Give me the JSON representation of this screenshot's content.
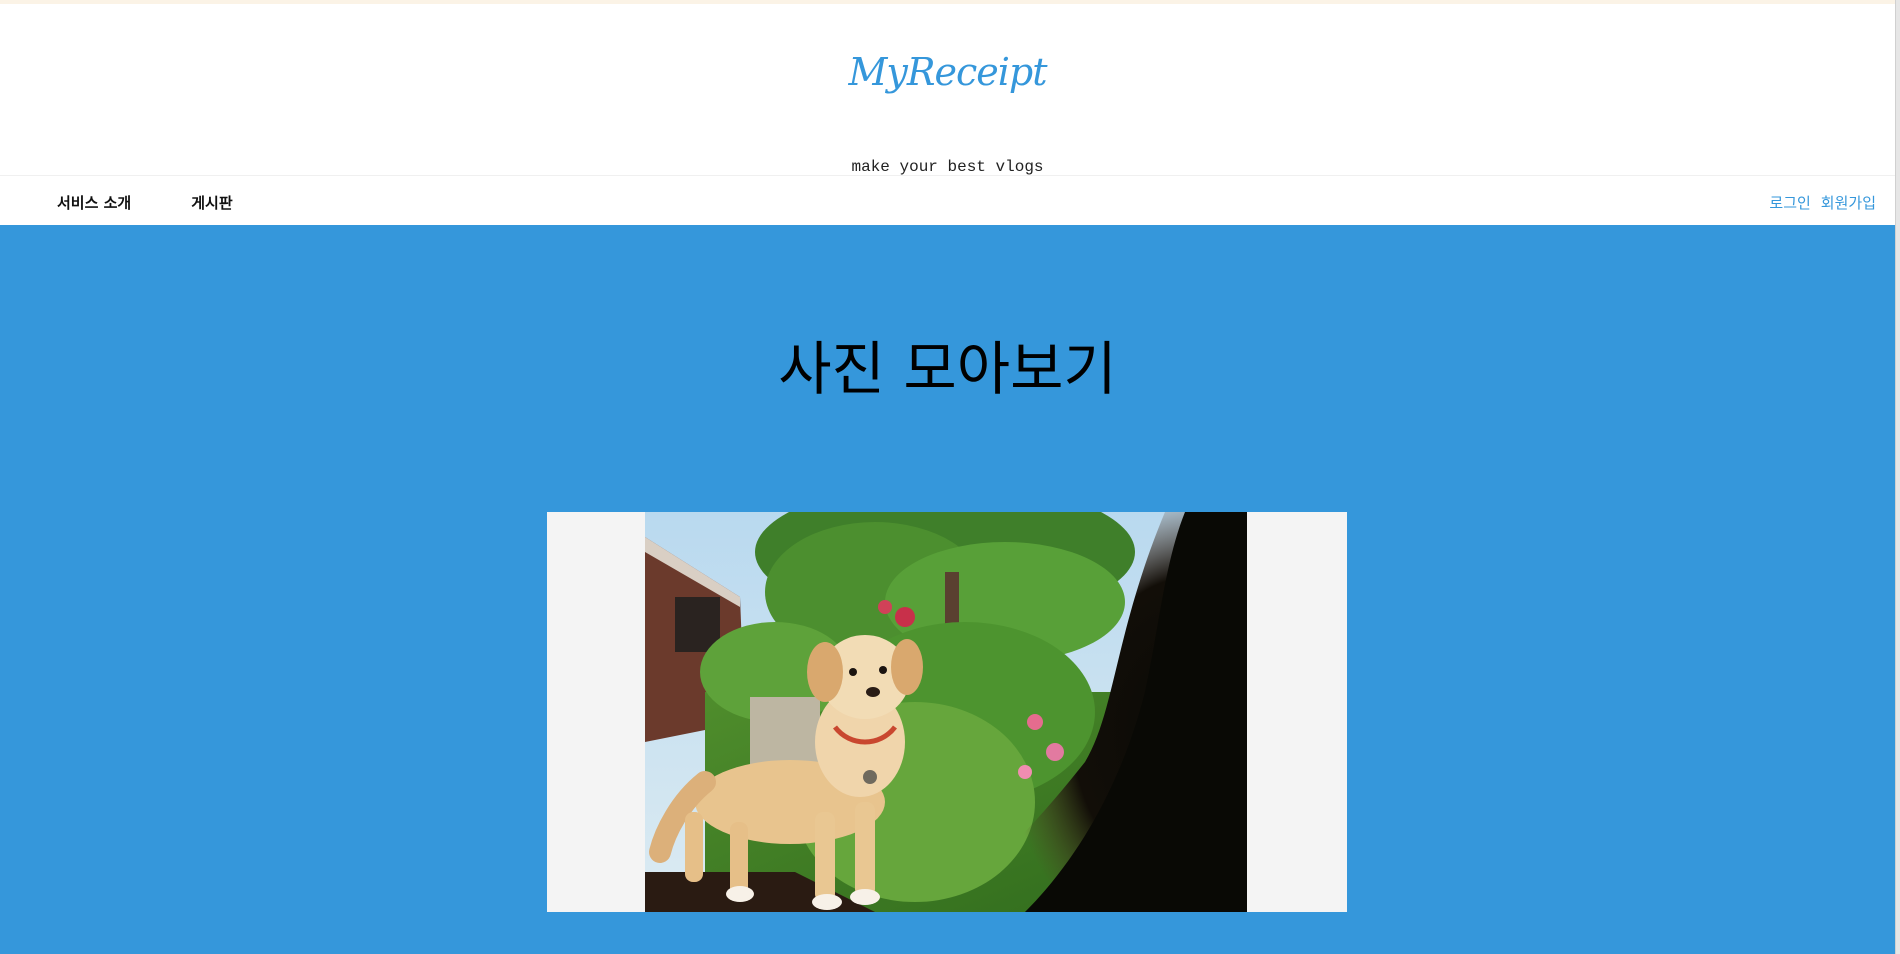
{
  "header": {
    "logo": "MyReceipt",
    "tagline": "make your best vlogs"
  },
  "nav": {
    "left_items": [
      "서비스 소개",
      "게시판"
    ],
    "login": "로그인",
    "signup": "회원가입"
  },
  "hero": {
    "title": "사진 모아보기",
    "photo_subject": "dog-photo"
  },
  "colors": {
    "brand": "#3597db",
    "hero_bg": "#3597db",
    "frame_bg": "#f4f4f4"
  }
}
